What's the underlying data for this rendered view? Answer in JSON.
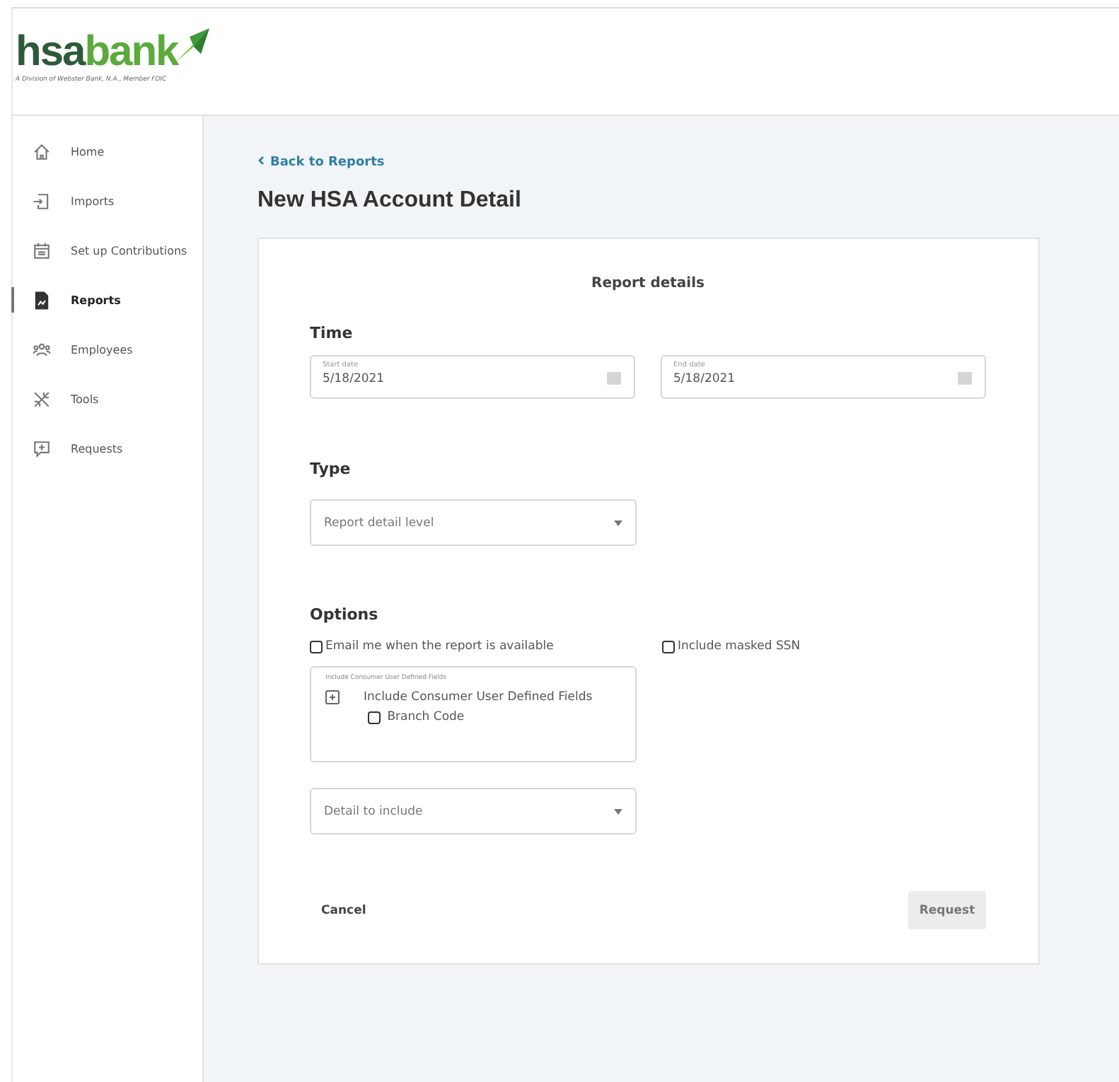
{
  "logo": {
    "prefix": "hsa",
    "name": "bank",
    "tagline": "A Division of Webster Bank, N.A., Member FDIC"
  },
  "sidebar": {
    "items": [
      {
        "label": "Home",
        "kind": "home",
        "selected": false
      },
      {
        "label": "Imports",
        "kind": "import",
        "selected": false
      },
      {
        "label": "Set up Contributions",
        "kind": "calendar",
        "selected": false
      },
      {
        "label": "Reports",
        "kind": "report",
        "selected": true
      },
      {
        "label": "Employees",
        "kind": "people",
        "selected": false
      },
      {
        "label": "Tools",
        "kind": "tools",
        "selected": false
      },
      {
        "label": "Requests",
        "kind": "request",
        "selected": false
      }
    ]
  },
  "back_link": "Back to Reports",
  "page_title": "New HSA Account Detail",
  "card": {
    "title": "Report details",
    "time": {
      "heading": "Time",
      "fields": [
        {
          "label": "Start date",
          "value": "5/18/2021"
        },
        {
          "label": "End date",
          "value": "5/18/2021"
        }
      ]
    },
    "type": {
      "heading": "Type",
      "select": {
        "placeholder": "Report detail level"
      }
    },
    "options": {
      "heading": "Options",
      "checkboxes": [
        {
          "label": "Email me when the report is available",
          "checked": false
        },
        {
          "label": "Include masked SSN",
          "checked": false
        }
      ],
      "udf": {
        "legend": "Include Consumer User Defined Fields",
        "node": {
          "label": "Include Consumer User Defined Fields",
          "expanded": false,
          "children": [
            {
              "label": "Branch Code",
              "checked": false
            }
          ]
        }
      },
      "select": {
        "placeholder": "Detail to include"
      }
    },
    "cancel": "Cancel",
    "request": {
      "label": "Request",
      "disabled": true
    }
  }
}
